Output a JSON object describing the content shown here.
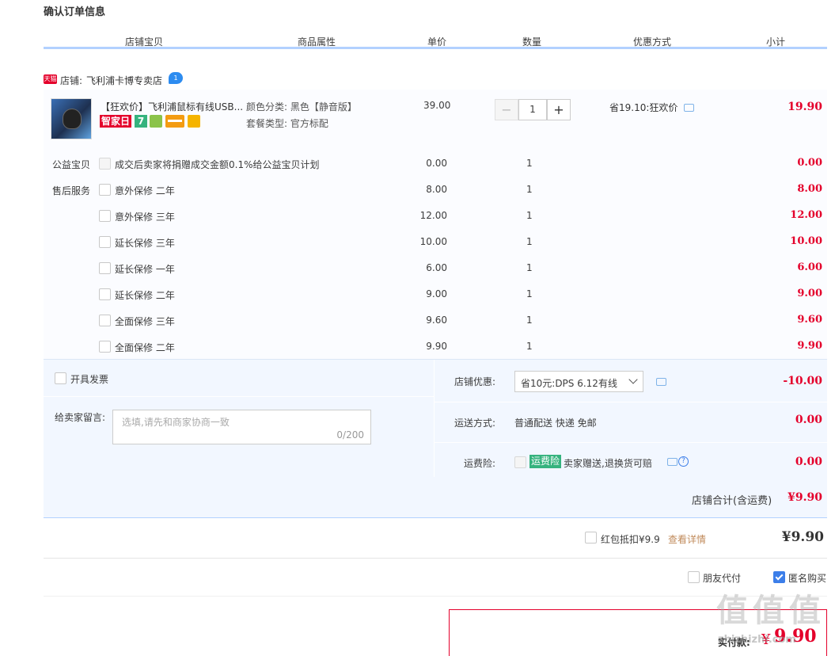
{
  "section_title": "确认订单信息",
  "columns": [
    "店铺宝贝",
    "商品属性",
    "单价",
    "数量",
    "优惠方式",
    "小计"
  ],
  "store": {
    "badge": "天猫",
    "label": "店铺:",
    "name": "飞利浦卡博专卖店",
    "chat_badge": "1"
  },
  "item": {
    "title": "【狂欢价】飞利浦鼠标有线USB...",
    "tags": [
      "智家日",
      "7"
    ],
    "attr_color": "颜色分类: 黑色【静音版】",
    "attr_package": "套餐类型: 官方标配",
    "price": "39.00",
    "qty": "1",
    "qty_minus": "−",
    "qty_plus": "+",
    "discount": "省19.10:狂欢价",
    "subtotal": "19.90"
  },
  "charity": {
    "label": "公益宝贝",
    "text": "成交后卖家将捐赠成交金额0.1%给公益宝贝计划",
    "price": "0.00",
    "qty": "1",
    "subtotal": "0.00"
  },
  "service_label": "售后服务",
  "services": [
    {
      "name": "意外保修 二年",
      "price": "8.00",
      "qty": "1",
      "subtotal": "8.00"
    },
    {
      "name": "意外保修 三年",
      "price": "12.00",
      "qty": "1",
      "subtotal": "12.00"
    },
    {
      "name": "延长保修 三年",
      "price": "10.00",
      "qty": "1",
      "subtotal": "10.00"
    },
    {
      "name": "延长保修 一年",
      "price": "6.00",
      "qty": "1",
      "subtotal": "6.00"
    },
    {
      "name": "延长保修 二年",
      "price": "9.00",
      "qty": "1",
      "subtotal": "9.00"
    },
    {
      "name": "全面保修 三年",
      "price": "9.60",
      "qty": "1",
      "subtotal": "9.60"
    },
    {
      "name": "全面保修 二年",
      "price": "9.90",
      "qty": "1",
      "subtotal": "9.90"
    }
  ],
  "invoice_label": "开具发票",
  "message": {
    "label": "给卖家留言:",
    "placeholder": "选填,请先和商家协商一致",
    "counter": "0/200"
  },
  "coupon": {
    "label": "店铺优惠:",
    "value": "省10元:DPS 6.12有线",
    "amount": "-10.00"
  },
  "shipping": {
    "label": "运送方式:",
    "value": "普通配送 快递 免邮",
    "amount": "0.00"
  },
  "insurance": {
    "label": "运费险:",
    "badge": "运费险",
    "text": "卖家赠送,退换货可赔",
    "amount": "0.00"
  },
  "store_total": {
    "label": "店铺合计(含运费)",
    "amount": "¥9.90"
  },
  "redpacket": {
    "label": "红包抵扣¥9.9",
    "link": "查看详情",
    "amount": "¥9.90"
  },
  "friend_pay": "朋友代付",
  "anonymous": "匿名购买",
  "final": {
    "label": "实付款:",
    "currency": "¥",
    "amount": "9.90"
  },
  "watermark": "值 值 值",
  "watermark_url": "zhizhizhi.com",
  "colors": {
    "accent": "#ff4400",
    "price_red": "#e4002b",
    "blue_bg": "#f2f7ff",
    "header_line": "#b2d1ff",
    "green_tag": "#36b37e"
  }
}
